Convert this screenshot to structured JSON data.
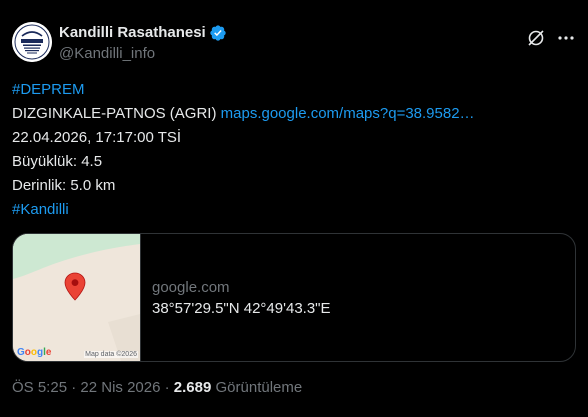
{
  "author": {
    "display_name": "Kandilli Rasathanesi",
    "handle": "@Kandilli_info",
    "avatar_icon": "kandilli-logo",
    "verified_color": "#1d9bf0"
  },
  "tweet": {
    "hashtag_1": "#DEPREM",
    "location": "DIZGINKALE-PATNOS (AGRI)",
    "map_link": "maps.google.com/maps?q=38.9582…",
    "datetime": "22.04.2026, 17:17:00 TSİ",
    "magnitude": "Büyüklük: 4.5",
    "depth": "Derinlik: 5.0 km",
    "hashtag_2": "#Kandilli"
  },
  "card": {
    "domain": "google.com",
    "title": "38°57'29.5\"N 42°49'43.3\"E",
    "map_brand": "Google",
    "map_credit": "Map data ©2026"
  },
  "meta": {
    "time": "ÖS 5:25",
    "separator": "·",
    "date": "22 Nis 2026",
    "views_count": "2.689",
    "views_label": "Görüntüleme"
  },
  "colors": {
    "background": "#000000",
    "text": "#e7e9ea",
    "muted": "#71767b",
    "link": "#1d9bf0",
    "border": "#2f3336"
  }
}
